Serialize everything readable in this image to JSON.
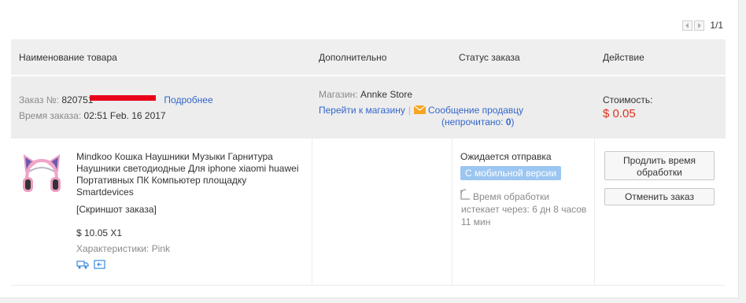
{
  "pager": {
    "text": "1/1",
    "prev_icon": "chevron-left-icon",
    "next_icon": "chevron-right-icon"
  },
  "table_header": {
    "product": "Наименование товара",
    "extra": "Дополнительно",
    "status": "Статус заказа",
    "action": "Действие"
  },
  "order": {
    "number_label": "Заказ №:",
    "number_value": "820751",
    "details_link": "Подробнее",
    "time_label": "Время заказа:",
    "time_value": "02:51 Feb. 16 2017",
    "store_label": "Магазин:",
    "store_name": "Annke Store",
    "go_to_store": "Перейти к магазину",
    "separator": "|",
    "message_seller": "Сообщение продавцу",
    "unread_open": "(непрочитано: ",
    "unread_count": "0",
    "unread_close": ")",
    "cost_label": "Стоимость:",
    "cost_value": "$ 0.05"
  },
  "item": {
    "title": "Mindkoo Кошка Наушники Музыки Гарнитура Наушники светодиодные Для iphone xiaomi huawei Портативных ПК Компьютер площадку Smartdevices",
    "snapshot": "[Скриншот заказа]",
    "price": "$ 10.05 X1",
    "characteristics": "Характеристики: Pink"
  },
  "status": {
    "text": "Ожидается отправка",
    "mobile_badge": "С мобильной версии",
    "timer": "Время обработки истекает через: 6 дн 8 часов 11 мин"
  },
  "actions": {
    "extend": "Продлить время обработки",
    "cancel": "Отменить заказ"
  },
  "colors": {
    "link": "#3366cc",
    "price": "#e0321b",
    "badge": "#9cc6f2",
    "mail_icon": "#f5a623"
  }
}
